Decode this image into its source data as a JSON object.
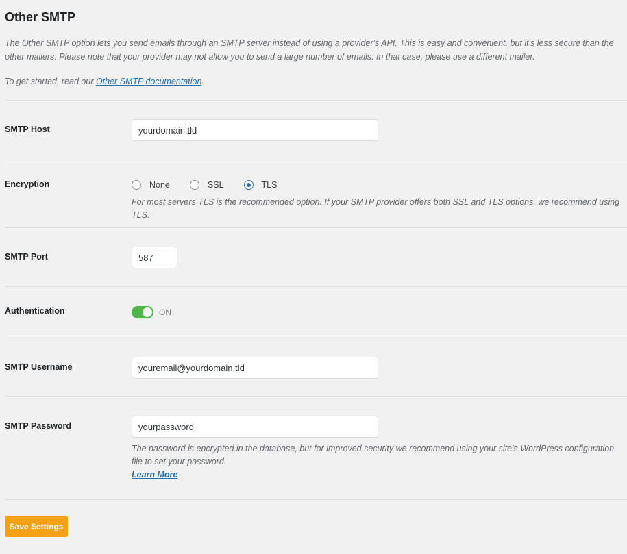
{
  "section": {
    "title": "Other SMTP",
    "description": "The Other SMTP option lets you send emails through an SMTP server instead of using a provider's API. This is easy and convenient, but it's less secure than the other mailers. Please note that your provider may not allow you to send a large number of emails. In that case, please use a different mailer.",
    "get_started_prefix": "To get started, read our ",
    "get_started_link": "Other SMTP documentation",
    "get_started_suffix": "."
  },
  "fields": {
    "host": {
      "label": "SMTP Host",
      "value": "yourdomain.tld"
    },
    "encryption": {
      "label": "Encryption",
      "options": [
        {
          "label": "None",
          "checked": false
        },
        {
          "label": "SSL",
          "checked": false
        },
        {
          "label": "TLS",
          "checked": true
        }
      ],
      "help": "For most servers TLS is the recommended option. If your SMTP provider offers both SSL and TLS options, we recommend using TLS."
    },
    "port": {
      "label": "SMTP Port",
      "value": "587"
    },
    "authentication": {
      "label": "Authentication",
      "state_label": "ON",
      "enabled": true
    },
    "username": {
      "label": "SMTP Username",
      "value": "youremail@yourdomain.tld"
    },
    "password": {
      "label": "SMTP Password",
      "value": "yourpassword",
      "help": "The password is encrypted in the database, but for improved security we recommend using your site's WordPress configuration file to set your password.",
      "learn_more": "Learn More"
    }
  },
  "actions": {
    "save_label": "Save Settings"
  },
  "colors": {
    "accent": "#f6a016",
    "toggle_on": "#4db848",
    "link": "#2271b1"
  }
}
